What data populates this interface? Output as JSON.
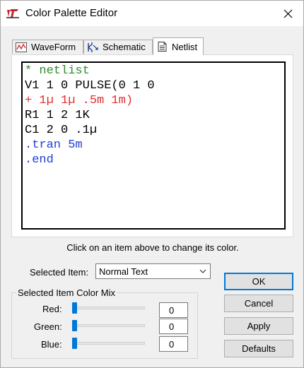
{
  "window": {
    "title": "Color Palette Editor"
  },
  "tabs": [
    {
      "label": "WaveForm",
      "icon": "waveform-icon"
    },
    {
      "label": "Schematic",
      "icon": "schematic-icon"
    },
    {
      "label": "Netlist",
      "icon": "netlist-icon",
      "active": true
    }
  ],
  "netlist": {
    "lines": [
      {
        "text": "* netlist",
        "color": "#2e8b2e"
      },
      {
        "text": "V1 1 0 PULSE(0 1 0",
        "color": "#000000"
      },
      {
        "text": "+ 1µ 1µ .5m 1m)",
        "color": "#e03030"
      },
      {
        "text": "R1 1 2 1K",
        "color": "#000000"
      },
      {
        "text": "C1 2 0 .1µ",
        "color": "#000000"
      },
      {
        "text": ".tran 5m",
        "color": "#2040d0"
      },
      {
        "text": ".end",
        "color": "#2040d0"
      }
    ]
  },
  "hint": "Click on an item above to change its color.",
  "selected_item": {
    "label": "Selected Item:",
    "value": "Normal Text"
  },
  "color_mix": {
    "title": "Selected Item Color Mix",
    "channels": [
      {
        "label": "Red:",
        "value": "0"
      },
      {
        "label": "Green:",
        "value": "0"
      },
      {
        "label": "Blue:",
        "value": "0"
      }
    ]
  },
  "buttons": {
    "ok": "OK",
    "cancel": "Cancel",
    "apply": "Apply",
    "defaults": "Defaults"
  },
  "colors": {
    "accent": "#0078d7"
  }
}
